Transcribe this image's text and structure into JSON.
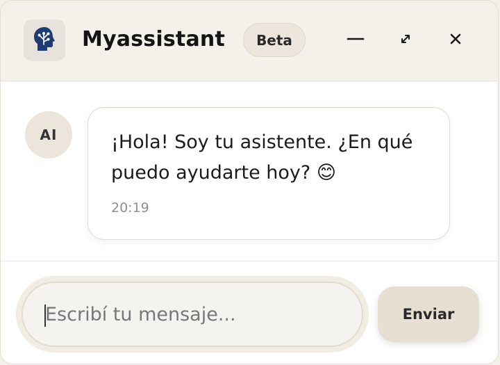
{
  "header": {
    "title": "Myassistant",
    "badge": "Beta",
    "icons": {
      "logo": "brain-circuit-icon",
      "minimize": "minimize-icon",
      "maximize": "expand-icon",
      "close": "close-icon"
    }
  },
  "messages": [
    {
      "sender_avatar": "AI",
      "text": "¡Hola! Soy tu asistente. ¿En qué puedo ayudarte hoy? 😊",
      "time": "20:19"
    }
  ],
  "composer": {
    "placeholder": "Escribí tu mensaje...",
    "value": "",
    "send_label": "Enviar"
  },
  "colors": {
    "brand": "#1f3b73",
    "header_bg": "#f4f0ea",
    "accent_bg": "#e8dfd3"
  }
}
